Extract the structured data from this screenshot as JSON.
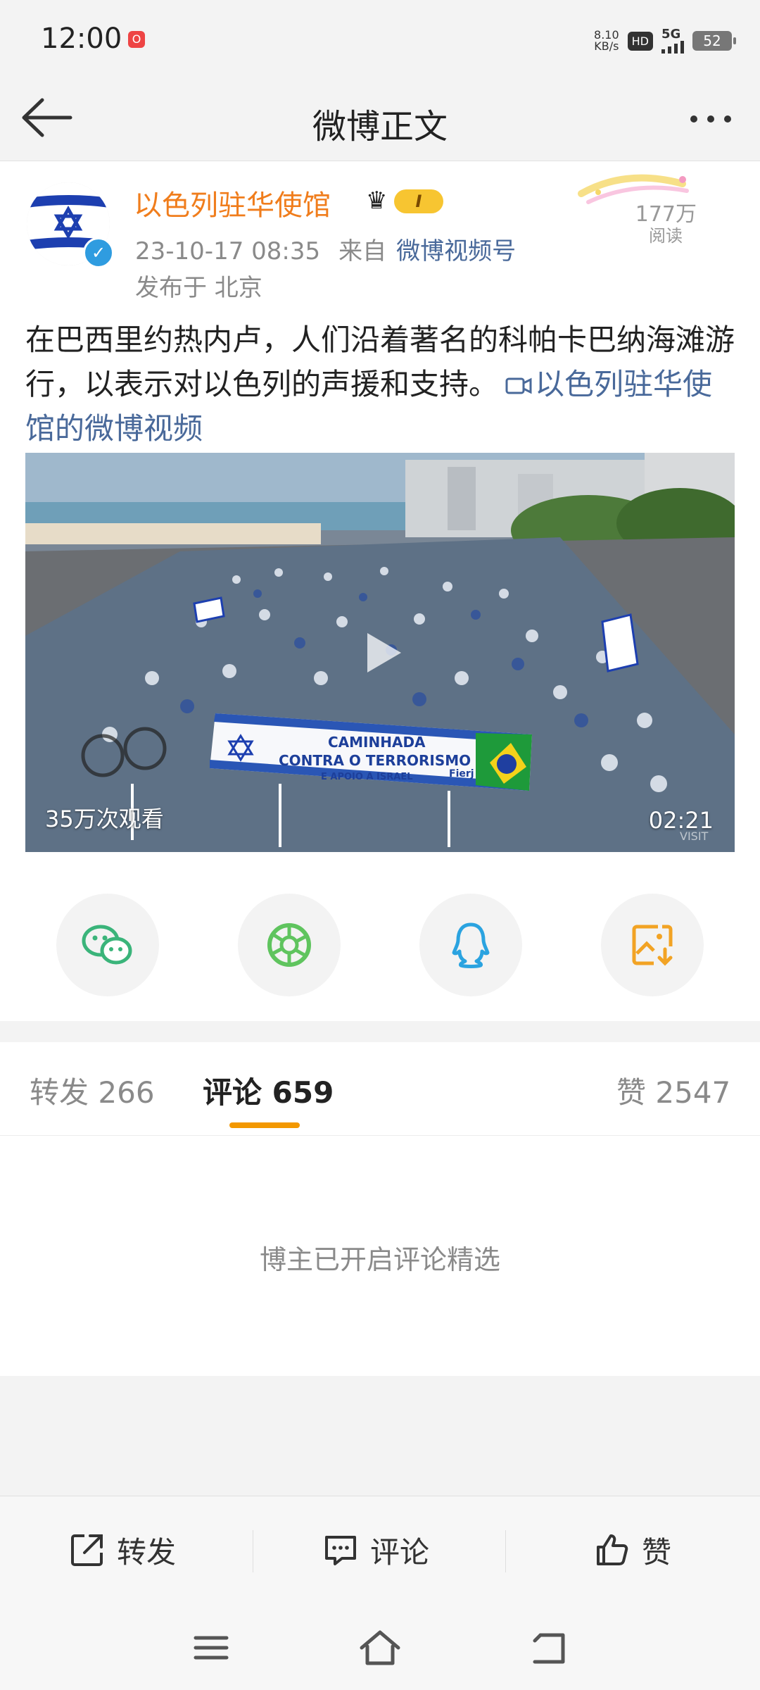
{
  "status_bar": {
    "time": "12:00",
    "notification": "O",
    "net_speed_value": "8.10",
    "net_speed_unit": "KB/s",
    "hd": "HD",
    "network": "5G",
    "battery": "52"
  },
  "header": {
    "title": "微博正文",
    "back_icon": "arrow-left-icon",
    "more_icon": "more-dots-icon"
  },
  "post": {
    "author": "以色列驻华使馆",
    "level": "I",
    "timestamp": "23-10-17 08:35",
    "from_label": "来自",
    "source": "微博视频号",
    "location": "发布于 北京",
    "read_count": "177万",
    "read_label": "阅读",
    "text": "在巴西里约热内卢，人们沿着著名的科帕卡巴纳海滩游行，以表示对以色列的声援和支持。",
    "video_link": "以色列驻华使馆的微博视频",
    "video": {
      "views": "35万次观看",
      "duration": "02:21",
      "banner_line1": "CAMINHADA",
      "banner_line2": "CONTRA O TERRORISMO",
      "banner_line3": "E APOIO A ISRAEL",
      "banner_logo": "Fierj",
      "watermark": "VISIT"
    }
  },
  "share": [
    {
      "name": "wechat",
      "icon": "wechat-icon",
      "color": "#3ab47a"
    },
    {
      "name": "moments",
      "icon": "moments-icon",
      "color": "#5fc45e"
    },
    {
      "name": "qq",
      "icon": "qq-icon",
      "color": "#2aa3e0"
    },
    {
      "name": "save-image",
      "icon": "save-image-icon",
      "color": "#f2a324"
    }
  ],
  "tabs": {
    "repost_label": "转发",
    "repost_count": "266",
    "comment_label": "评论",
    "comment_count": "659",
    "like_label": "赞",
    "like_count": "2547",
    "accent": "#f39800"
  },
  "empty_comments": "博主已开启评论精选",
  "actions": {
    "repost": "转发",
    "comment": "评论",
    "like": "赞"
  },
  "nav": {
    "menu_icon": "menu-icon",
    "home_icon": "home-icon",
    "back_icon": "back-icon"
  }
}
